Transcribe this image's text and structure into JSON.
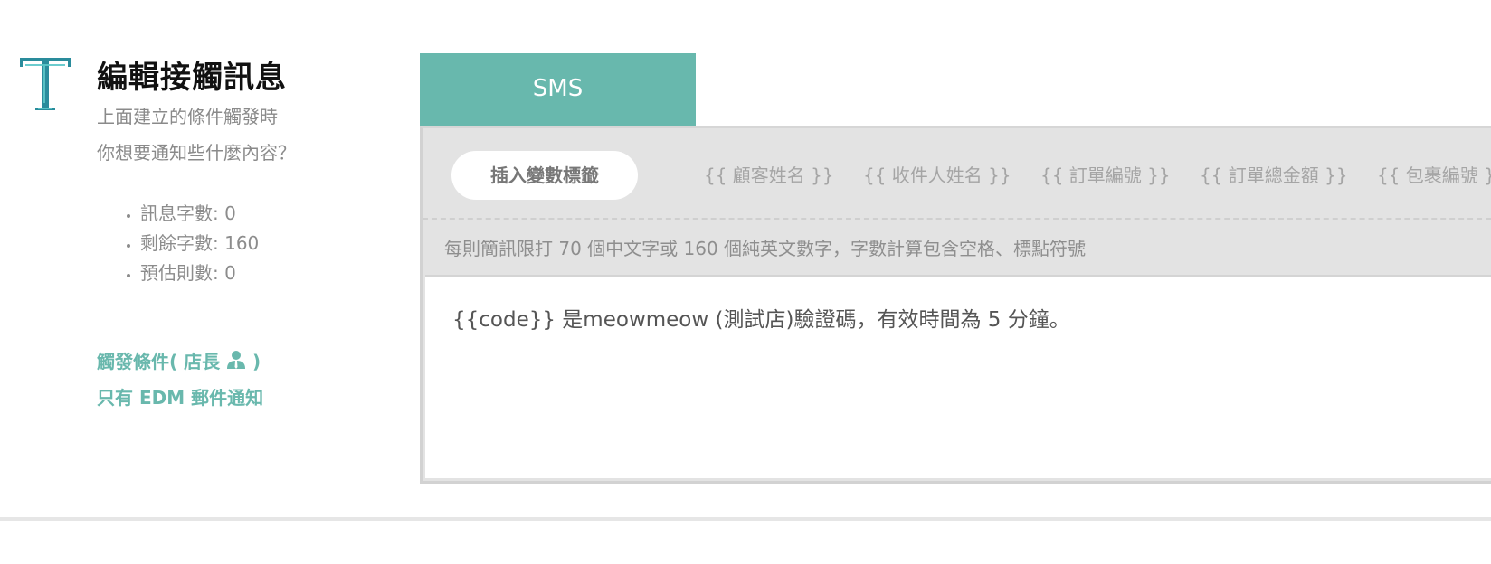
{
  "header": {
    "title": "編輯接觸訊息",
    "subtitle_line1": "上面建立的條件觸發時",
    "subtitle_line2": "你想要通知些什麼內容？",
    "logo_icon": "text-t-icon"
  },
  "stats": [
    "訊息字數: 0",
    "剩餘字數: 160",
    "預估則數: 0"
  ],
  "trigger": {
    "line1_prefix": "觸發條件( 店長",
    "line1_suffix": ")",
    "line1_icon": "user-icon",
    "line2": "只有 EDM 郵件通知"
  },
  "tab": {
    "label": "SMS"
  },
  "panel": {
    "insert_button": "插入變數標籤",
    "tags": [
      "{{ 顧客姓名 }}",
      "{{ 收件人姓名 }}",
      "{{ 訂單編號 }}",
      "{{ 訂單總金額 }}",
      "{{ 包裹編號 }}"
    ],
    "hint": "每則簡訊限打 70 個中文字或 160 個純英文數字，字數計算包含空格、標點符號",
    "message": "{{code}} 是meowmeow (測試店)驗證碼，有效時間為 5 分鐘。"
  },
  "colors": {
    "accent": "#68b8ad",
    "logo_dark": "#2a8c9c",
    "logo_light": "#5cc7c9",
    "panel_bg": "#e3e3e3"
  }
}
